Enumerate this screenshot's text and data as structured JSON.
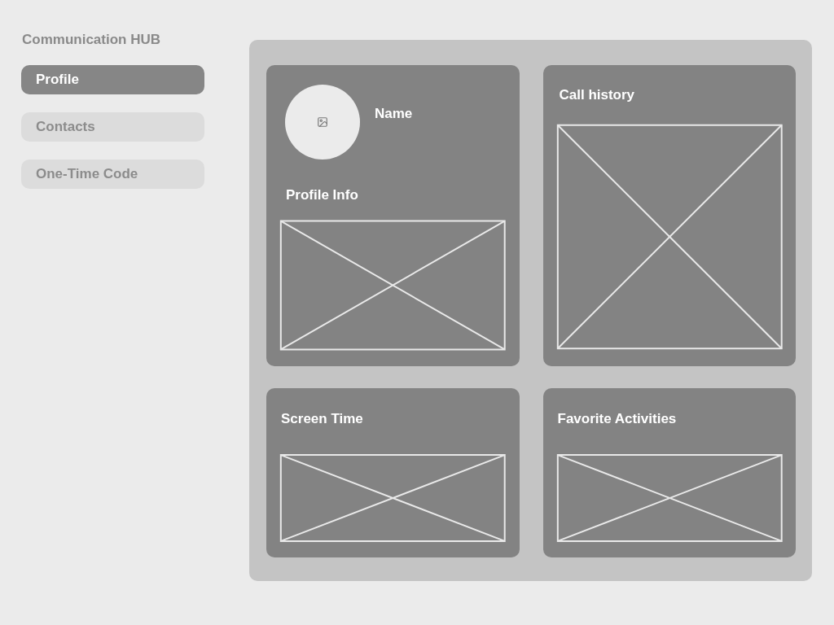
{
  "sidebar": {
    "title": "Communication HUB",
    "items": [
      {
        "label": "Profile",
        "selected": true
      },
      {
        "label": "Contacts",
        "selected": false
      },
      {
        "label": "One-Time Code",
        "selected": false
      }
    ]
  },
  "profile_card": {
    "name": "Name",
    "title": "Profile Info"
  },
  "cards": [
    {
      "title": "Call history"
    },
    {
      "title": "Screen Time"
    },
    {
      "title": "Favorite Activities"
    }
  ]
}
